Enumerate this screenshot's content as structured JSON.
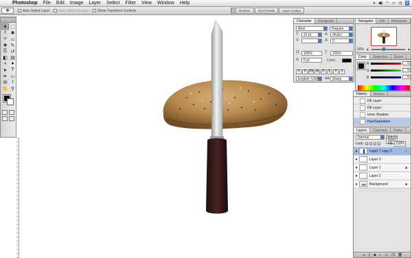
{
  "menubar": {
    "app": "Photoshop",
    "items": [
      "File",
      "Edit",
      "Image",
      "Layer",
      "Select",
      "Filter",
      "View",
      "Window",
      "Help"
    ]
  },
  "optionsbar": {
    "auto_select_layer": "Auto Select Layer",
    "auto_select_groups": "Auto Select Groups",
    "show_transform_controls": "Show Transform Controls",
    "well_tabs": [
      "Brushes",
      "Tool Presets",
      "Layer Comps"
    ]
  },
  "toolbox": {
    "icons": [
      "move-tool-icon",
      "marquee-tool-icon",
      "lasso-tool-icon",
      "magic-wand-icon",
      "crop-tool-icon",
      "slice-tool-icon",
      "healing-brush-icon",
      "brush-tool-icon",
      "clone-stamp-icon",
      "history-brush-icon",
      "eraser-tool-icon",
      "gradient-tool-icon",
      "blur-tool-icon",
      "dodge-tool-icon",
      "path-selection-icon",
      "type-tool-icon",
      "pen-tool-icon",
      "shape-tool-icon",
      "notes-tool-icon",
      "eyedropper-icon",
      "hand-tool-icon",
      "zoom-tool-icon"
    ],
    "glyphs": [
      "✥",
      "⬚",
      "ℓ",
      "✱",
      "⌗",
      "⚏",
      "✚",
      "✎",
      "⎘",
      "↺",
      "◧",
      "▤",
      "◖",
      "●",
      "➤",
      "T",
      "✒",
      "▭",
      "✉",
      "⟟",
      "✋",
      "⚲"
    ]
  },
  "character": {
    "tabs": [
      "Character",
      "Paragraph"
    ],
    "font": "Arial",
    "style": "Regular",
    "size": "10 pt",
    "leading": "(Auto)",
    "tracking": "0",
    "vscale": "100%",
    "hscale": "100%",
    "baseline": "0 pt",
    "color_label": "Color:",
    "language": "English: USA",
    "antialias": "Sharp",
    "style_buttons": [
      "T",
      "T",
      "TT",
      "Tr",
      "T'",
      "T,",
      "T",
      "T"
    ]
  },
  "navigator": {
    "tabs": [
      "Navigator",
      "Info",
      "Histogram"
    ],
    "zoom": "50%"
  },
  "color": {
    "tabs": [
      "Color",
      "Swatches",
      "Styles"
    ],
    "channels": [
      {
        "label": "R",
        "value": "0"
      },
      {
        "label": "G",
        "value": "0"
      },
      {
        "label": "B",
        "value": "0"
      }
    ]
  },
  "history": {
    "tabs": [
      "History",
      "Actions"
    ],
    "items": [
      "Fill Layer",
      "Fill Layer",
      "Inner Shadow",
      "Hue/Saturation"
    ]
  },
  "layers": {
    "tabs": [
      "Layers",
      "Channels",
      "Paths"
    ],
    "blend_mode": "Normal",
    "opacity_label": "Opacity:",
    "opacity": "100%",
    "lock_label": "Lock:",
    "fill_label": "Fill:",
    "fill": "100%",
    "items": [
      {
        "name": "Layer 7 copy 2",
        "selected": true
      },
      {
        "name": "Layer 3",
        "selected": false
      },
      {
        "name": "Layer 1",
        "selected": false
      },
      {
        "name": "Layer 2",
        "selected": false
      },
      {
        "name": "Background",
        "selected": false
      }
    ]
  }
}
